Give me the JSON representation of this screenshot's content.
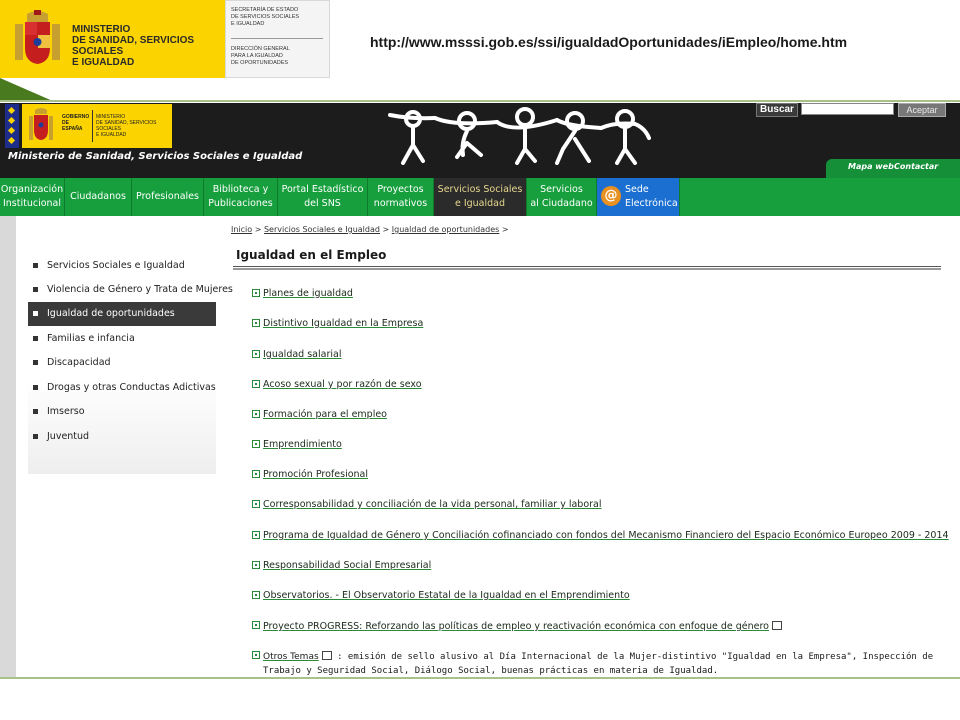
{
  "banner": {
    "ministry_name": "MINISTERIO\nDE SANIDAD, SERVICIOS SOCIALES\nE IGUALDAD",
    "secretaria": "SECRETARÍA DE ESTADO\nDE SERVICIOS SOCIALES\nE IGUALDAD",
    "direccion": "DIRECCIÓN GENERAL\nPARA LA IGUALDAD\nDE OPORTUNIDADES",
    "url": "http://www.msssi.gob.es/ssi/igualdadOportunidades/iEmpleo/home.htm"
  },
  "header": {
    "gobierno": "GOBIERNO\nDE ESPAÑA",
    "ministerio_small": "MINISTERIO\nDE SANIDAD, SERVICIOS SOCIALES\nE IGUALDAD",
    "site_title": "Ministerio de Sanidad, Servicios Sociales e Igualdad",
    "search_label": "Buscar",
    "search_value": "",
    "accept_label": "Aceptar",
    "tools": {
      "sitemap": "Mapa web",
      "contact": "Contactar"
    }
  },
  "nav": {
    "items": [
      {
        "label": "Organización\nInstitucional"
      },
      {
        "label": "Ciudadanos"
      },
      {
        "label": "Profesionales"
      },
      {
        "label": "Biblioteca y\nPublicaciones"
      },
      {
        "label": "Portal Estadístico\ndel SNS"
      },
      {
        "label": "Proyectos\nnormativos"
      },
      {
        "label": "Servicios Sociales\ne Igualdad"
      },
      {
        "label": "Servicios\nal Ciudadano"
      },
      {
        "label": "Sede\nElectrónica"
      }
    ]
  },
  "sidebar": {
    "items": [
      {
        "label": "Servicios Sociales e Igualdad"
      },
      {
        "label": "Violencia de Género y Trata de Mujeres"
      },
      {
        "label": "Igualdad de oportunidades"
      },
      {
        "label": "Familias e infancia"
      },
      {
        "label": "Discapacidad"
      },
      {
        "label": "Drogas y otras Conductas Adictivas"
      },
      {
        "label": "Imserso"
      },
      {
        "label": "Juventud"
      }
    ]
  },
  "breadcrumb": {
    "items": [
      "Inicio",
      "Servicios Sociales e Igualdad",
      "Igualdad de oportunidades"
    ],
    "separator": ">"
  },
  "main": {
    "title": "Igualdad en el Empleo",
    "links": [
      {
        "label": "Planes de igualdad"
      },
      {
        "label": "Distintivo Igualdad en la Empresa"
      },
      {
        "label": "Igualdad salarial"
      },
      {
        "label": "Acoso sexual y por razón de sexo"
      },
      {
        "label": "Formación para el empleo"
      },
      {
        "label": "Emprendimiento"
      },
      {
        "label": "Promoción Profesional"
      },
      {
        "label": "Corresponsabilidad y conciliación de la vida personal, familiar y laboral"
      },
      {
        "label": "Programa de Igualdad de Género y Conciliación cofinanciado con fondos del Mecanismo Financiero del Espacio Económico Europeo 2009 - 2014"
      },
      {
        "label": "Responsabilidad Social Empresarial"
      },
      {
        "label": "Observatorios. - El Observatorio Estatal de la Igualdad en el Emprendimiento"
      },
      {
        "label": "Proyecto PROGRESS: Reforzando las políticas de empleo y reactivación económica con enfoque de género"
      }
    ],
    "otros": {
      "label": "Otros Temas",
      "text": ": emisión de sello alusivo al Día Internacional de la Mujer-distintivo \"Igualdad en la Empresa\", Inspección de Trabajo y Seguridad Social, Diálogo Social, buenas prácticas en materia de Igualdad."
    }
  }
}
